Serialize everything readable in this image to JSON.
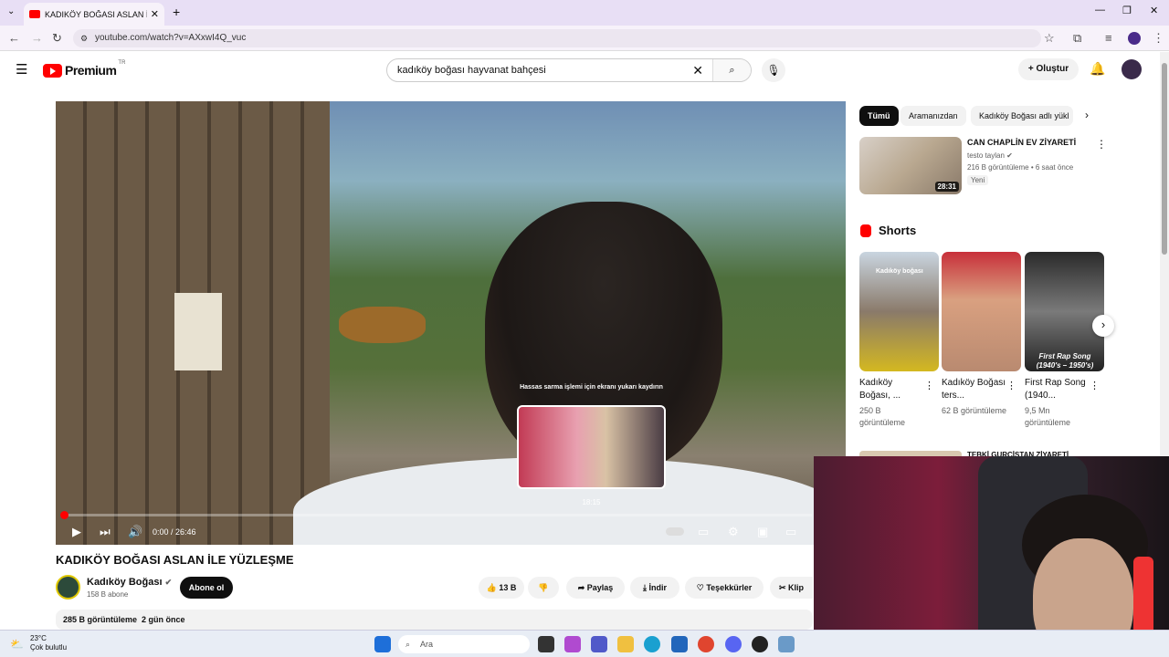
{
  "browser": {
    "tab_title": "KADIKÖY BOĞASI ASLAN İLE YÜ",
    "tab_close": "✕",
    "new_tab": "+",
    "url": "youtube.com/watch?v=AXxwI4Q_vuc"
  },
  "header": {
    "logo_text": "Premium",
    "logo_badge": "TR",
    "search_value": "kadıköy boğası hayvanat bahçesi",
    "create_label": "Oluştur"
  },
  "player": {
    "scroll_hint": "Hassas sarma işlemi için ekranı yukarı kaydırın",
    "preview_time": "18:15",
    "time_display": "0:00 / 26:46",
    "progress_fraction": 0
  },
  "video": {
    "title": "KADIKÖY BOĞASI ASLAN İLE YÜZLEŞME",
    "channel_name": "Kadıköy Boğası",
    "subscribers": "158 B abone",
    "subscribe_label": "Abone ol",
    "likes": "13 B",
    "share_label": "Paylaş",
    "download_label": "İndir",
    "thanks_label": "Teşekkürler",
    "clip_label": "Klip",
    "views": "285 B görüntüleme",
    "date": "2 gün önce"
  },
  "sidebar": {
    "chips": [
      "Tümü",
      "Aramanızdan",
      "Kadıköy Boğası adlı yükl"
    ],
    "rec1": {
      "title": "CAN CHAPLİN EV ZİYARETİ",
      "channel": "testo taylan",
      "meta": "216 B görüntüleme • 6 saat önce",
      "badge": "Yeni",
      "duration": "28:31"
    },
    "shorts_heading": "Shorts",
    "shorts": [
      {
        "title": "Kadıköy Boğası, ...",
        "views": "250 B görüntüleme",
        "overlay": "Kadıköy boğası"
      },
      {
        "title": "Kadıköy Boğası ters...",
        "views": "62 B görüntüleme",
        "overlay": ""
      },
      {
        "title": "First Rap Song (1940...",
        "views": "9,5 Mn görüntüleme",
        "overlay": "First Rap Song (1940's – 1950's)"
      }
    ],
    "rec2_title": "TEBKİ GURCİSTAN ZİYARETİ"
  },
  "taskbar": {
    "temp": "23°C",
    "weather": "Çok bulutlu",
    "search_placeholder": "Ara"
  }
}
